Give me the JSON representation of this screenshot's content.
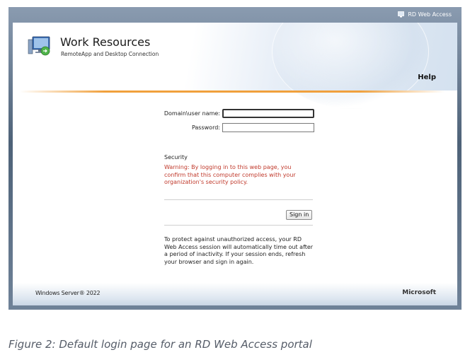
{
  "topbar": {
    "rdwa_label": "RD Web Access",
    "rdwa_icon": "rdwa-icon"
  },
  "header": {
    "title": "Work Resources",
    "subtitle": "RemoteApp and Desktop Connection",
    "help": "Help",
    "app_icon": "remote-desktop-icon"
  },
  "form": {
    "username_label": "Domain\\user name:",
    "username_value": "",
    "password_label": "Password:",
    "password_value": "",
    "security_label": "Security",
    "warning": "Warning: By logging in to this web page, you confirm that this computer complies with your organization's security policy.",
    "signin_label": "Sign in",
    "notice": "To protect against unauthorized access, your RD Web Access session will automatically time out after a period of inactivity. If your session ends, refresh your browser and sign in again."
  },
  "footer": {
    "left": "Windows Server® 2022",
    "right": "Microsoft"
  },
  "caption": "Figure 2: Default login page for an RD Web Access portal",
  "colors": {
    "accent_orange": "#f0a03c",
    "warning_red": "#c0392b",
    "frame": "#5e6e80"
  }
}
